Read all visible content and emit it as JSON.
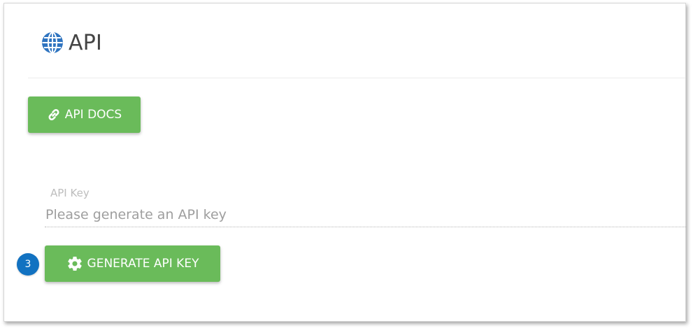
{
  "header": {
    "icon": "globe-icon",
    "title": "API"
  },
  "buttons": {
    "docs": {
      "label": "API DOCS",
      "icon": "link-icon"
    },
    "generate": {
      "label": "GENERATE API KEY",
      "icon": "gear-icon"
    }
  },
  "api_key_field": {
    "label": "API Key",
    "placeholder": "Please generate an API key",
    "value": ""
  },
  "step_badge": {
    "number": "3"
  },
  "colors": {
    "button_green": "#6abb5a",
    "badge_blue": "#1272c1",
    "globe_blue": "#2f74c0",
    "title_text": "#444444"
  }
}
